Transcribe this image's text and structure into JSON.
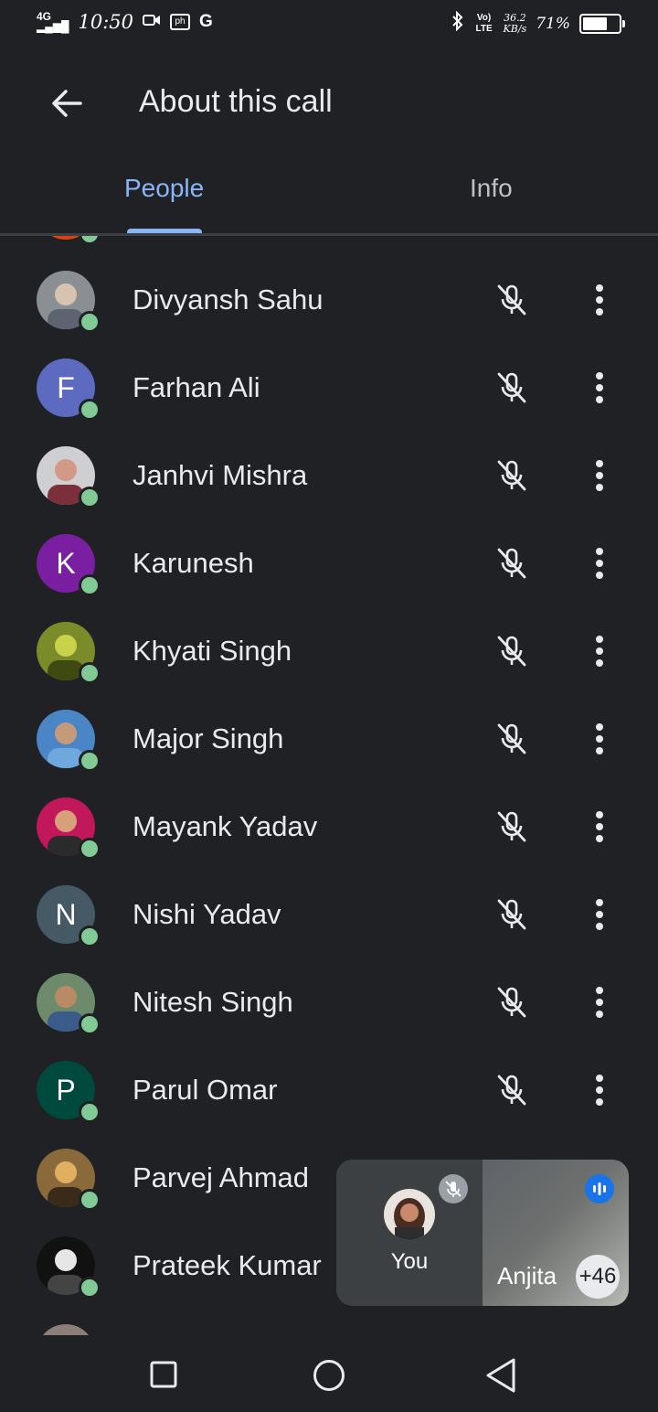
{
  "status_bar": {
    "network": "4G",
    "time": "10:50",
    "data_speed_value": "36.2",
    "data_speed_unit": "KB/s",
    "lte_label": "Vo) LTE",
    "battery_percent": "71%",
    "battery_level": 0.71
  },
  "header": {
    "title": "About this call"
  },
  "tabs": {
    "people": "People",
    "info": "Info"
  },
  "participants": [
    {
      "name": "Divyansh Sahu",
      "avatar_type": "photo",
      "online": true
    },
    {
      "name": "Farhan Ali",
      "avatar_type": "letter",
      "initial": "F",
      "color": "#5c6bc0",
      "online": true
    },
    {
      "name": "Janhvi Mishra",
      "avatar_type": "photo",
      "online": true
    },
    {
      "name": "Karunesh",
      "avatar_type": "letter",
      "initial": "K",
      "color": "#7b1fa2",
      "online": true
    },
    {
      "name": "Khyati Singh",
      "avatar_type": "photo",
      "online": true
    },
    {
      "name": "Major Singh",
      "avatar_type": "photo",
      "online": true
    },
    {
      "name": "Mayank Yadav",
      "avatar_type": "photo",
      "online": true
    },
    {
      "name": "Nishi Yadav",
      "avatar_type": "letter",
      "initial": "N",
      "color": "#455a64",
      "online": true
    },
    {
      "name": "Nitesh Singh",
      "avatar_type": "photo",
      "online": true
    },
    {
      "name": "Parul Omar",
      "avatar_type": "letter",
      "initial": "P",
      "color": "#00493d",
      "online": true
    },
    {
      "name": "Parvej Ahmad",
      "avatar_type": "photo",
      "online": true
    },
    {
      "name": "Prateek Kumar",
      "avatar_type": "photo",
      "online": true
    }
  ],
  "row_icons": {
    "mic": "mic-off-icon",
    "more": "more-vert-icon"
  },
  "pip": {
    "self_label": "You",
    "other_name": "Anjita",
    "extra_count": "+46"
  },
  "colors": {
    "background": "#202124",
    "accent": "#8ab4f8",
    "online": "#81c995",
    "text": "#e8eaed"
  }
}
